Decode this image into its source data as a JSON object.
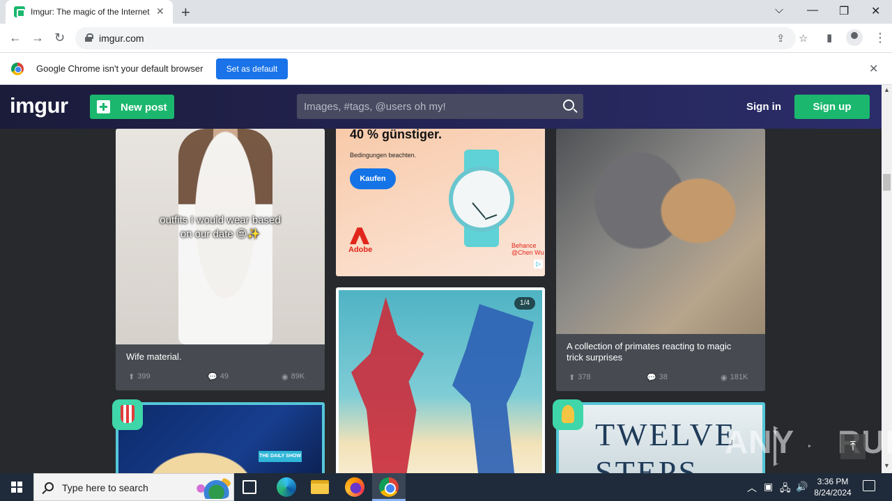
{
  "browser": {
    "tab_title": "Imgur: The magic of the Internet",
    "url": "imgur.com",
    "infobar_text": "Google Chrome isn't your default browser",
    "set_default_label": "Set as default"
  },
  "header": {
    "logo": "imgur",
    "new_post_label": "New post",
    "search_placeholder": "Images, #tags, @users oh my!",
    "sign_in_label": "Sign in",
    "sign_up_label": "Sign up"
  },
  "posts": [
    {
      "image_caption_line1": "outfits I would wear based",
      "image_caption_line2": "on our date 😌✨",
      "title": "Wife material.",
      "upvotes": "399",
      "comments": "49",
      "views": "89K"
    },
    {
      "title_line1": "A collection of primates reacting to magic",
      "title_line2": "trick surprises",
      "upvotes": "378",
      "comments": "38",
      "views": "181K"
    }
  ],
  "ad": {
    "headline": "40 % günstiger.",
    "fineprint": "Bedingungen beachten.",
    "button_label": "Kaufen",
    "brand": "Adobe",
    "credit_line1": "Behance",
    "credit_line2": "@Chen Wu"
  },
  "gallery": {
    "page_badge": "1/4"
  },
  "other_cards": {
    "daily_show_tag": "THE DAILY SHOW",
    "book_line1": "TWELVE",
    "book_line2": "STEPS"
  },
  "watermark": {
    "text_left": "ANY",
    "text_right": "RUN"
  },
  "taskbar": {
    "search_placeholder": "Type here to search",
    "time": "3:36 PM",
    "date": "8/24/2024"
  },
  "colors": {
    "imgur_green": "#1bb76e",
    "chrome_blue": "#1a73e8",
    "imgur_bg": "#27292d",
    "card_bg": "#474a51"
  }
}
